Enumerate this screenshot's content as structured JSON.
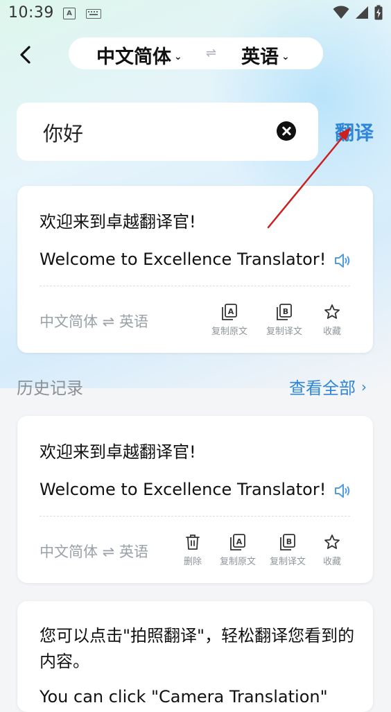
{
  "status_bar": {
    "time": "10:39",
    "a_badge": "A"
  },
  "top_bar": {
    "source_lang": "中文简体",
    "target_lang": "英语",
    "swap_symbol": "⇌"
  },
  "input": {
    "text": "你好",
    "translate_label": "翻译"
  },
  "result_card": {
    "source_text": "欢迎来到卓越翻译官!",
    "translated_text": "Welcome to Excellence Translator!",
    "lang_pair": "中文简体 ⇌ 英语",
    "actions": [
      "复制原文",
      "复制译文",
      "收藏"
    ]
  },
  "history": {
    "title": "历史记录",
    "view_all": "查看全部",
    "items": [
      {
        "source_text": "欢迎来到卓越翻译官!",
        "translated_text": "Welcome to Excellence Translator!",
        "lang_pair": "中文简体 ⇌ 英语",
        "actions": [
          "删除",
          "复制原文",
          "复制译文",
          "收藏"
        ]
      }
    ]
  },
  "tip_card": {
    "text": "您可以点击\"拍照翻译\"，轻松翻译您看到的内容。",
    "text_en": "You can click \"Camera Translation\""
  },
  "colors": {
    "accent": "#2f86d6",
    "arrow": "#cc1f1f"
  },
  "icons": [
    "back-icon",
    "chevron-down-icon",
    "clear-icon",
    "speaker-icon",
    "copy-source-icon",
    "copy-translation-icon",
    "star-icon",
    "trash-icon",
    "chevron-right-icon"
  ]
}
